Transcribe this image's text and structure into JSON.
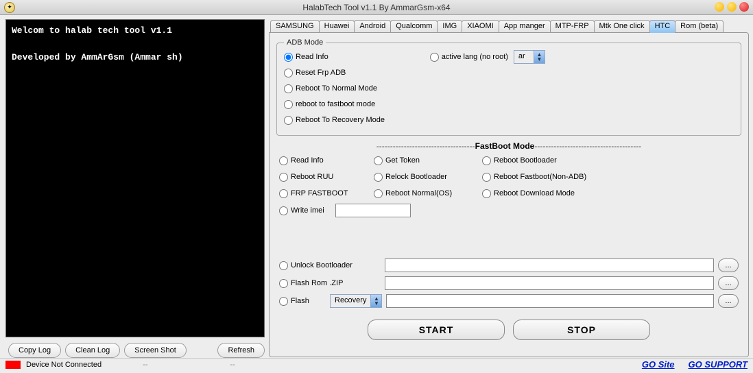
{
  "window": {
    "title": "HalabTech Tool v1.1   By AmmarGsm-x64"
  },
  "console": {
    "line1": "Welcom to halab tech tool v1.1",
    "line2": "Developed by AmmArGsm (Ammar sh)"
  },
  "left_buttons": {
    "copy": "Copy Log",
    "clean": "Clean Log",
    "screenshot": "Screen Shot",
    "refresh": "Refresh"
  },
  "tabs": [
    "SAMSUNG",
    "Huawei",
    "Android",
    "Qualcomm",
    "IMG",
    "XIAOMI",
    "App manger",
    "MTP-FRP",
    "Mtk One click",
    "HTC",
    "Rom (beta)"
  ],
  "active_tab_index": 9,
  "adb": {
    "legend": "ADB Mode",
    "read_info": "Read Info",
    "active_lang": "active lang (no root)",
    "lang_value": "ar",
    "reset_frp": "Reset Frp ADB",
    "reboot_normal": "Reboot To Normal Mode",
    "reboot_fastboot": "reboot to fastboot mode",
    "reboot_recovery": "Reboot To Recovery Mode"
  },
  "fastboot": {
    "title": "FastBoot Mode",
    "read_info": "Read Info",
    "get_token": "Get Token",
    "reboot_bootloader": "Reboot Bootloader",
    "reboot_ruu": "Reboot RUU",
    "relock": "Relock Bootloader",
    "reboot_fastboot_nonadb": "Reboot Fastboot(Non-ADB)",
    "frp_fastboot": "FRP FASTBOOT",
    "reboot_normal_os": "Reboot Normal(OS)",
    "reboot_download": "Reboot Download Mode",
    "write_imei": "Write imei"
  },
  "flash": {
    "unlock_bootloader": "Unlock Bootloader",
    "flash_rom_zip": "Flash Rom .ZIP",
    "flash": "Flash",
    "flash_type": "Recovery",
    "browse": "..."
  },
  "buttons": {
    "start": "START",
    "stop": "STOP"
  },
  "status": {
    "text": "Device Not Connected",
    "dash": "--",
    "go_site": "GO Site",
    "go_support": "GO SUPPORT"
  }
}
